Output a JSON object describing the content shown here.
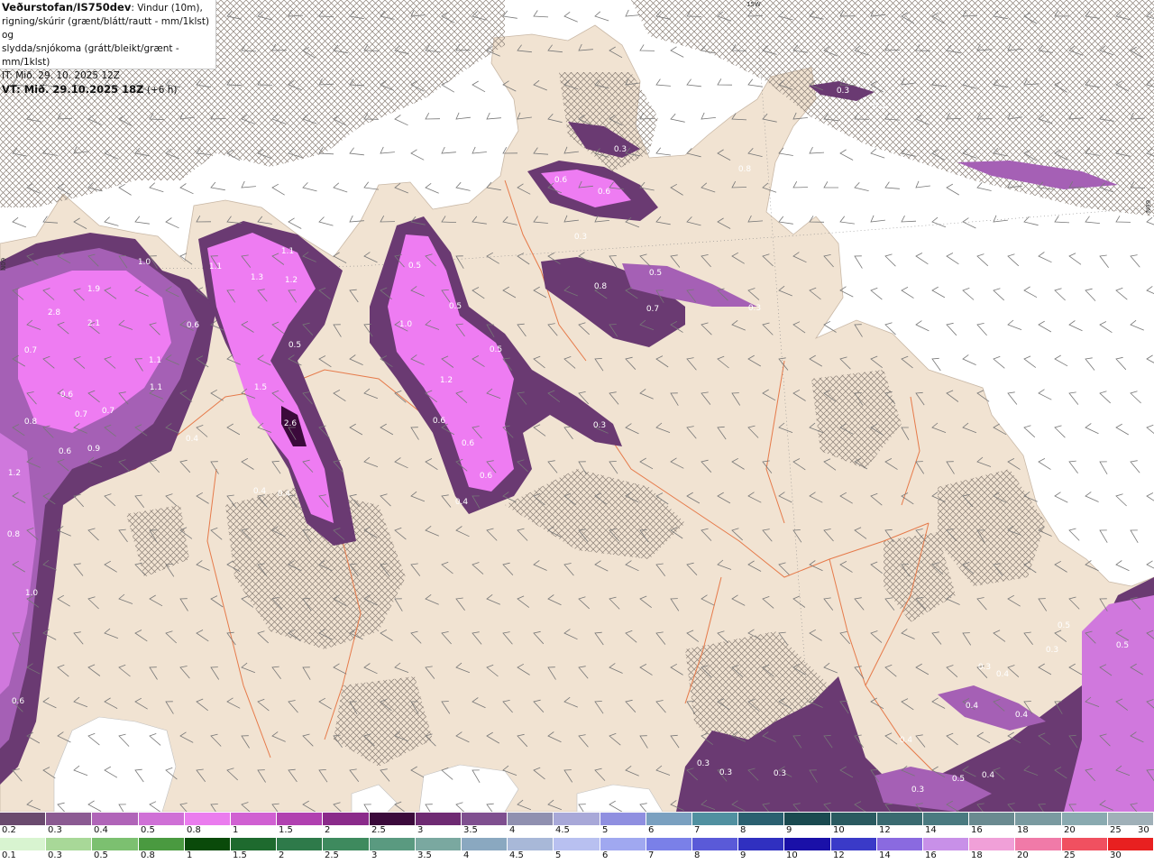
{
  "title": {
    "line1_bold": "Veðurstofan/IS750dev",
    "line1_rest": ": Vindur (10m),",
    "line2": "rigning/skúrir (grænt/blátt/rautt - mm/1klst) og",
    "line3": "slydda/snjókoma (grátt/bleikt/grænt - mm/1klst)",
    "line4": "IT: Mið. 29. 10. 2025 12Z",
    "line5_bold": "VT: Mið. 29.10.2025 18Z",
    "line5_rest": " (+6 h)"
  },
  "gridlabels": {
    "lon_top": "15W",
    "lat_left": "N09",
    "lat_right": "N99"
  },
  "colors": {
    "sea": "#ffffff",
    "land": "#f1e3d2",
    "hatch": "#8a7f76",
    "roads": "#e67a4a",
    "snow_light": "#a560b5",
    "snow_mid": "#d078dd",
    "snow_bright": "#ee7cf2",
    "snow_dark": "#6a3a72",
    "snow_core": "#3b0a3b",
    "barb": "#777777"
  },
  "legend_top": {
    "labels": [
      "0.2",
      "0.3",
      "0.4",
      "0.5",
      "0.8",
      "1",
      "1.5",
      "2",
      "2.5",
      "3",
      "3.5",
      "4",
      "4.5",
      "5",
      "6",
      "7",
      "8",
      "9",
      "10",
      "12",
      "14",
      "16",
      "18",
      "20",
      "25",
      "30"
    ],
    "colors": [
      "#6a4a6e",
      "#8b5a92",
      "#b064b8",
      "#cf70d6",
      "#ea7cee",
      "#d060d2",
      "#b040b0",
      "#8a2a8a",
      "#3b0a3b",
      "#6e2a72",
      "#7f4f8f",
      "#9090b0",
      "#a8a8d8",
      "#8f8fe0",
      "#7aa0c0",
      "#5090a0",
      "#2a6070",
      "#1a4a50",
      "#2a5a60",
      "#3a6a70",
      "#4a7a80",
      "#6a8a90",
      "#7a9aa0",
      "#8aaab0",
      "#a0b0b8"
    ]
  },
  "legend_bottom": {
    "labels": [
      "0.1",
      "0.3",
      "0.5",
      "0.8",
      "1",
      "1.5",
      "2",
      "2.5",
      "3",
      "3.5",
      "4",
      "4.5",
      "5",
      "6",
      "7",
      "8",
      "9",
      "10",
      "12",
      "14",
      "16",
      "18",
      "20",
      "25",
      "30"
    ],
    "colors": [
      "#d8f4d0",
      "#a8d898",
      "#7cc070",
      "#4a9a40",
      "#0a4a0a",
      "#1e6a2e",
      "#2e7a4a",
      "#3e8a5e",
      "#5a9a80",
      "#7aa8a0",
      "#8aa8c0",
      "#a8b8d8",
      "#b8c0f0",
      "#a0a8f0",
      "#7a80e8",
      "#5a5ad8",
      "#3030c0",
      "#1a10a8",
      "#3a3ac8",
      "#8a6ae0",
      "#c890e8",
      "#f0a0d8",
      "#f07aa8",
      "#f05060",
      "#e82020"
    ]
  },
  "map_values": [
    {
      "v": "0.3"
    },
    {
      "v": "0.3"
    },
    {
      "v": "0.3"
    },
    {
      "v": "0.6"
    },
    {
      "v": "0.6"
    },
    {
      "v": "0.8"
    },
    {
      "v": "0.3"
    },
    {
      "v": "0.5"
    },
    {
      "v": "0.8"
    },
    {
      "v": "0.7"
    },
    {
      "v": "0.3"
    },
    {
      "v": "0.5"
    },
    {
      "v": "1.0"
    },
    {
      "v": "0.5"
    },
    {
      "v": "0.5"
    },
    {
      "v": "1.2"
    },
    {
      "v": "0.3"
    },
    {
      "v": "0.6"
    },
    {
      "v": "0.6"
    },
    {
      "v": "0.4"
    },
    {
      "v": "0.6"
    },
    {
      "v": "1.1"
    },
    {
      "v": "1.1"
    },
    {
      "v": "1.3"
    },
    {
      "v": "1.2"
    },
    {
      "v": "0.6"
    },
    {
      "v": "0.5"
    },
    {
      "v": "1.5"
    },
    {
      "v": "2.6"
    },
    {
      "v": "0.4"
    },
    {
      "v": "0.4"
    },
    {
      "v": "1.0"
    },
    {
      "v": "1.9"
    },
    {
      "v": "2.8"
    },
    {
      "v": "2.1"
    },
    {
      "v": "0.7"
    },
    {
      "v": "1.1"
    },
    {
      "v": "1.1"
    },
    {
      "v": "0.6"
    },
    {
      "v": "0.7"
    },
    {
      "v": "0.7"
    },
    {
      "v": "0.8"
    },
    {
      "v": "0.4"
    },
    {
      "v": "0.6"
    },
    {
      "v": "0.9"
    },
    {
      "v": "1.2"
    },
    {
      "v": "0.8"
    },
    {
      "v": "1.0"
    },
    {
      "v": "0.6"
    },
    {
      "v": "0.5"
    },
    {
      "v": "0.3"
    },
    {
      "v": "0.3"
    },
    {
      "v": "0.4"
    },
    {
      "v": "0.4"
    },
    {
      "v": "0.4"
    },
    {
      "v": "0.4"
    },
    {
      "v": "0.3"
    },
    {
      "v": "0.3"
    },
    {
      "v": "0.3"
    },
    {
      "v": "0.3"
    },
    {
      "v": "0.5"
    },
    {
      "v": "0.5"
    },
    {
      "v": "0.4"
    }
  ]
}
